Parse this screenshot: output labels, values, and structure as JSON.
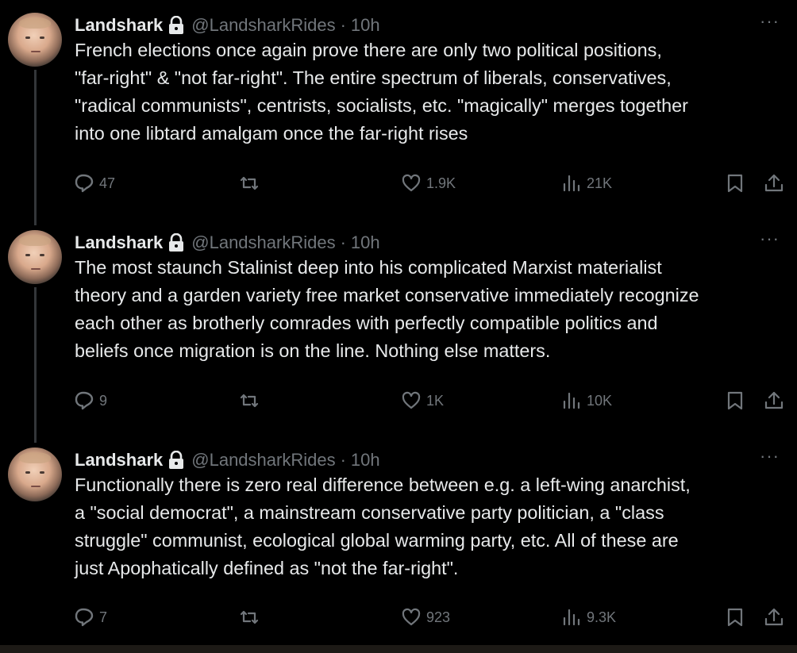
{
  "tweets": [
    {
      "name": "Landshark",
      "handle": "@LandsharkRides",
      "time": "10h",
      "text": "French elections once again prove there are only two political positions,\n\"far-right\" & \"not far-right\". The entire spectrum of liberals, conservatives,\n\"radical communists\", centrists, socialists, etc. \"magically\" merges together\ninto one libtard amalgam once the far-right rises",
      "replies": "47",
      "likes": "1.9K",
      "views": "21K"
    },
    {
      "name": "Landshark",
      "handle": "@LandsharkRides",
      "time": "10h",
      "text": "The most staunch Stalinist deep into his complicated Marxist materialist\ntheory and a garden variety free market conservative immediately recognize\neach other as brotherly comrades with perfectly compatible politics and\nbeliefs once migration is on the line. Nothing else matters.",
      "replies": "9",
      "likes": "1K",
      "views": "10K"
    },
    {
      "name": "Landshark",
      "handle": "@LandsharkRides",
      "time": "10h",
      "text": "Functionally there is zero real difference between e.g. a left-wing anarchist,\na \"social democrat\", a mainstream conservative party politician, a \"class\nstruggle\" communist, ecological global warming party, etc. All of these are\njust Apophatically defined as \"not the far-right\".",
      "replies": "7",
      "likes": "923",
      "views": "9.3K"
    }
  ],
  "more_label": "···",
  "dot": "·",
  "icons": [
    "lock-icon",
    "reply-icon",
    "retweet-icon",
    "like-icon",
    "views-icon",
    "bookmark-icon",
    "share-icon",
    "more-icon"
  ]
}
